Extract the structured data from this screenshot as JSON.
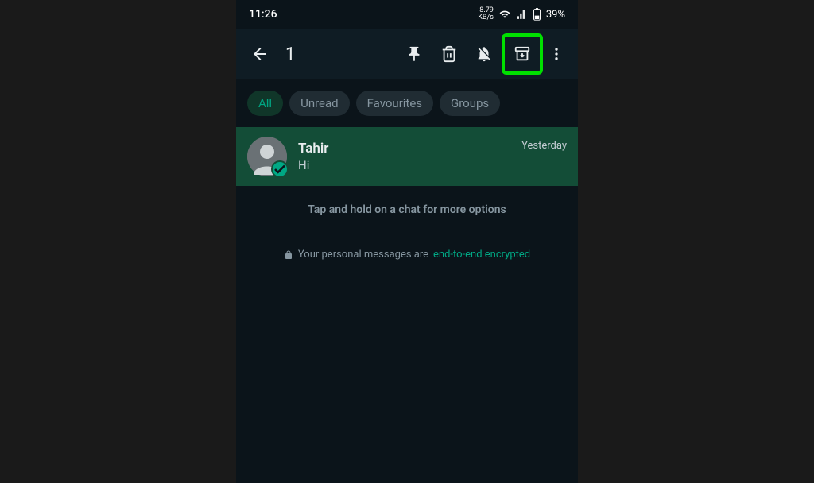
{
  "status": {
    "time": "11:26",
    "speed_top": "8.79",
    "speed_bottom": "KB/s",
    "battery": "39%"
  },
  "toolbar": {
    "selected_count": "1"
  },
  "filters": {
    "all": "All",
    "unread": "Unread",
    "favourites": "Favourites",
    "groups": "Groups"
  },
  "chat": {
    "name": "Tahir",
    "message": "Hi",
    "time": "Yesterday"
  },
  "hint": "Tap and hold on a chat for more options",
  "encryption": {
    "prefix": "Your personal messages are ",
    "link": "end-to-end encrypted"
  }
}
